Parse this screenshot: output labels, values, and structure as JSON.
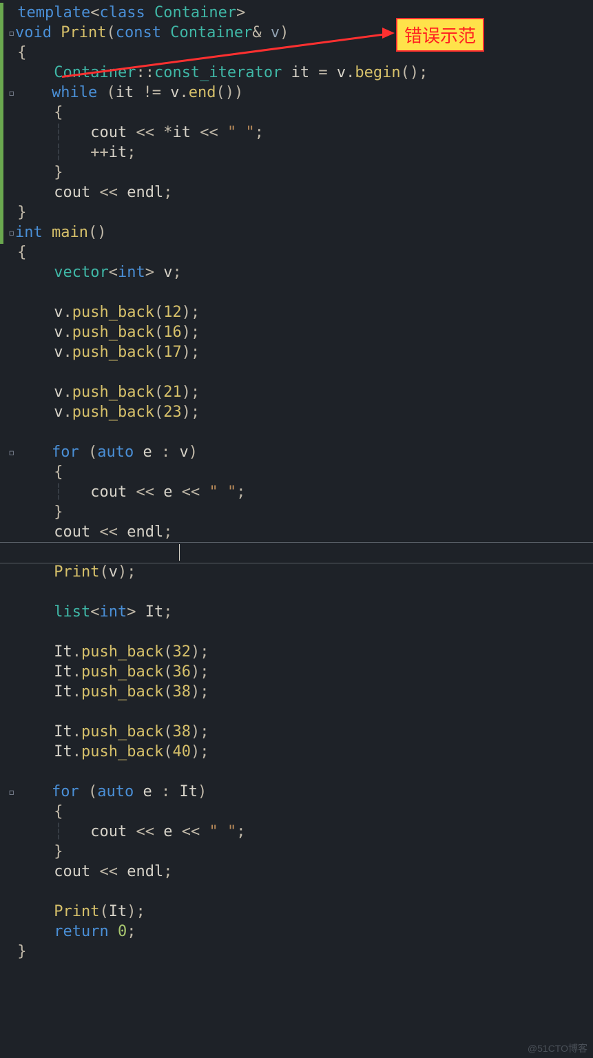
{
  "annotation": {
    "text": "错误示范"
  },
  "watermark": "@51CTO博客",
  "code": {
    "t1": "template",
    "t2": "class",
    "t3": "Container",
    "t4": "void",
    "t5": "Print",
    "t6": "const",
    "t7": "v",
    "t8": "const_iterator",
    "t9": "it",
    "t10": "v",
    "t11": "begin",
    "t12": "while",
    "t13": "v",
    "t14": "end",
    "t15": "cout",
    "t16": "it",
    "t17": "\" \"",
    "t18": "it",
    "t19": "cout",
    "t20": "endl",
    "t21": "int",
    "t22": "main",
    "t23": "vector",
    "t24": "int",
    "t25": "v",
    "pb1": "v",
    "pbF1": "push_back",
    "n1": "12",
    "pb2": "v",
    "pbF2": "push_back",
    "n2": "16",
    "pb3": "v",
    "pbF3": "push_back",
    "n3": "17",
    "pb4": "v",
    "pbF4": "push_back",
    "n4": "21",
    "pb5": "v",
    "pbF5": "push_back",
    "n5": "23",
    "for1": "for",
    "auto1": "auto",
    "e1": "e",
    "coll1": "v",
    "co1": "cout",
    "ev1": "e",
    "s1": "\" \"",
    "co2": "cout",
    "endl2": "endl",
    "print1": "Print",
    "arg1": "v",
    "list1": "list",
    "int2": "int",
    "it2": "It",
    "lb1": "It",
    "lbF1": "push_back",
    "ln1": "32",
    "lb2": "It",
    "lbF2": "push_back",
    "ln2": "36",
    "lb3": "It",
    "lbF3": "push_back",
    "ln3": "38",
    "lb4": "It",
    "lbF4": "push_back",
    "ln4": "38",
    "lb5": "It",
    "lbF5": "push_back",
    "ln5": "40",
    "for2": "for",
    "auto2": "auto",
    "e2": "e",
    "coll2": "It",
    "co3": "cout",
    "ev2": "e",
    "s2": "\" \"",
    "co4": "cout",
    "endl3": "endl",
    "print2": "Print",
    "arg2": "It",
    "ret": "return",
    "zero": "0"
  }
}
